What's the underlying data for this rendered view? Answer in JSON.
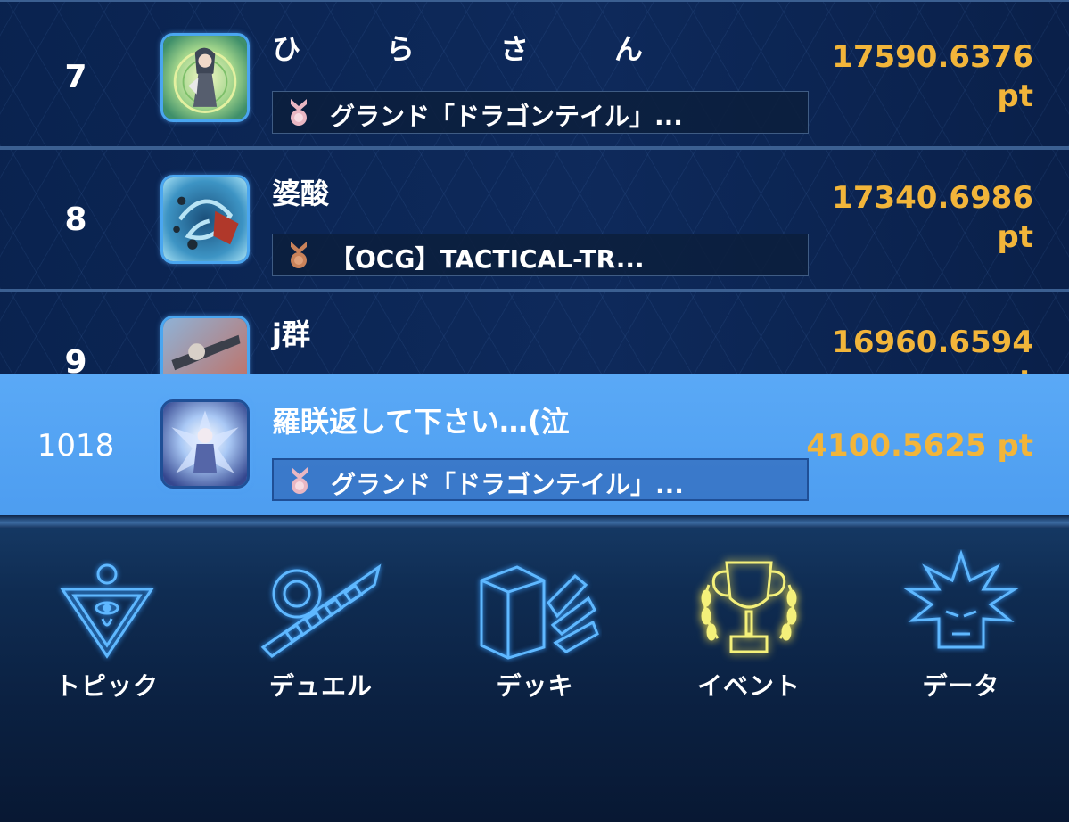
{
  "ranking": [
    {
      "rank": "7",
      "name": "ひらさん",
      "deck": "グランド「ドラゴンテイル」...",
      "score_value": "17590.6376",
      "score_unit": "pt",
      "medal_color": "#e9b7c3",
      "avatar_icon": "green-fairy-avatar"
    },
    {
      "rank": "8",
      "name": "婆酸",
      "deck": "【OCG】TACTICAL-TR...",
      "score_value": "17340.6986",
      "score_unit": "pt",
      "medal_color": "#c9825a",
      "avatar_icon": "ocean-swirl-avatar"
    },
    {
      "rank": "9",
      "name": "j群",
      "deck": "",
      "score_value": "16960.6594",
      "score_unit": "pt",
      "medal_color": "#c9825a",
      "avatar_icon": "machine-avatar"
    }
  ],
  "my_rank": {
    "rank": "1018",
    "name": "羅眹返して下さい…(泣",
    "deck": "グランド「ドラゴンテイル」...",
    "score": "4100.5625 pt",
    "medal_color": "#e9b7c3",
    "avatar_icon": "crystal-dragon-avatar"
  },
  "nav": [
    {
      "label": "トピック",
      "icon": "millennium-eye-icon",
      "active": false
    },
    {
      "label": "デュエル",
      "icon": "duel-disk-icon",
      "active": false
    },
    {
      "label": "デッキ",
      "icon": "deck-box-icon",
      "active": false
    },
    {
      "label": "イベント",
      "icon": "trophy-icon",
      "active": true
    },
    {
      "label": "データ",
      "icon": "yugi-silhouette-icon",
      "active": false
    }
  ],
  "colors": {
    "score": "#f2b53a",
    "highlight_row": "#5aa9f6",
    "nav_icon": "#5fb8ff",
    "nav_icon_active": "#f4f07a"
  }
}
